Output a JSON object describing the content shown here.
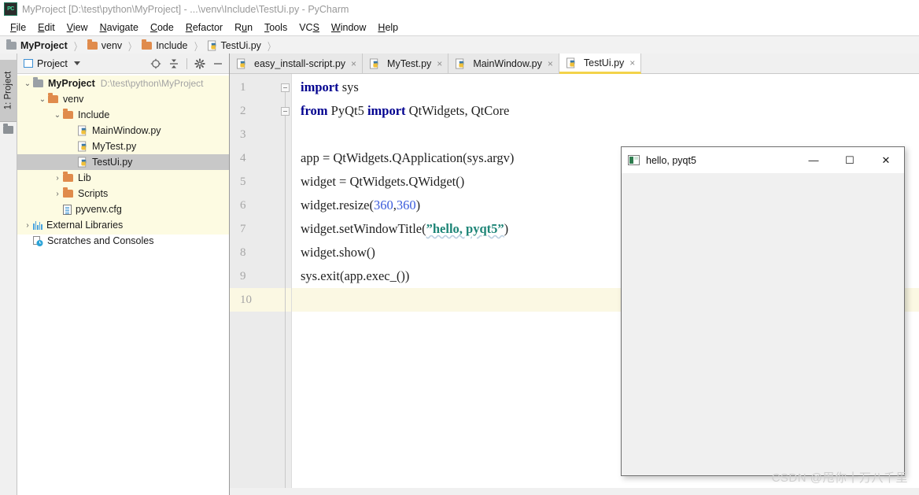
{
  "window": {
    "title": "MyProject [D:\\test\\python\\MyProject] - ...\\venv\\Include\\TestUi.py - PyCharm",
    "app_icon": "PC"
  },
  "menubar": {
    "items": [
      {
        "label": "File",
        "mnemonic": "F"
      },
      {
        "label": "Edit",
        "mnemonic": "E"
      },
      {
        "label": "View",
        "mnemonic": "V"
      },
      {
        "label": "Navigate",
        "mnemonic": "N"
      },
      {
        "label": "Code",
        "mnemonic": "C"
      },
      {
        "label": "Refactor",
        "mnemonic": "R"
      },
      {
        "label": "Run",
        "mnemonic": "u"
      },
      {
        "label": "Tools",
        "mnemonic": "T"
      },
      {
        "label": "VCS",
        "mnemonic": "S"
      },
      {
        "label": "Window",
        "mnemonic": "W"
      },
      {
        "label": "Help",
        "mnemonic": "H"
      }
    ]
  },
  "breadcrumb": {
    "items": [
      {
        "label": "MyProject",
        "icon": "folder-gray-icon",
        "bold": true
      },
      {
        "label": "venv",
        "icon": "folder-orange-icon",
        "bold": false
      },
      {
        "label": "Include",
        "icon": "folder-orange-icon",
        "bold": false
      },
      {
        "label": "TestUi.py",
        "icon": "python-file-icon",
        "bold": false
      }
    ],
    "separator": "〉"
  },
  "toolstrip": {
    "project_tab_label": "1: Project",
    "folder_icon": "folder-icon"
  },
  "project_panel": {
    "header": {
      "title": "Project",
      "window_icon": "project-window-icon",
      "dropdown_icon": "chevron-down-icon",
      "actions": [
        {
          "name": "locate-icon",
          "glyph": "⊕"
        },
        {
          "name": "collapse-all-icon",
          "glyph": "⤓"
        },
        {
          "name": "settings-gear-icon",
          "glyph": "⚙"
        },
        {
          "name": "hide-panel-icon",
          "glyph": "—"
        }
      ]
    },
    "tree": [
      {
        "label": "MyProject",
        "path": "D:\\test\\python\\MyProject",
        "icon": "folder-gray-icon",
        "arrow": "⌄",
        "indent": 0,
        "bold": true,
        "selected": false
      },
      {
        "label": "venv",
        "path": "",
        "icon": "folder-orange-icon",
        "arrow": "⌄",
        "indent": 1,
        "bold": false,
        "selected": false
      },
      {
        "label": "Include",
        "path": "",
        "icon": "folder-orange-icon",
        "arrow": "⌄",
        "indent": 2,
        "bold": false,
        "selected": false
      },
      {
        "label": "MainWindow.py",
        "path": "",
        "icon": "python-file-icon",
        "arrow": "",
        "indent": 3,
        "bold": false,
        "selected": false
      },
      {
        "label": "MyTest.py",
        "path": "",
        "icon": "python-file-icon",
        "arrow": "",
        "indent": 3,
        "bold": false,
        "selected": false
      },
      {
        "label": "TestUi.py",
        "path": "",
        "icon": "python-file-icon",
        "arrow": "",
        "indent": 3,
        "bold": false,
        "selected": true
      },
      {
        "label": "Lib",
        "path": "",
        "icon": "folder-orange-icon",
        "arrow": "›",
        "indent": 2,
        "bold": false,
        "selected": false
      },
      {
        "label": "Scripts",
        "path": "",
        "icon": "folder-orange-icon",
        "arrow": "›",
        "indent": 2,
        "bold": false,
        "selected": false
      },
      {
        "label": "pyvenv.cfg",
        "path": "",
        "icon": "config-file-icon",
        "arrow": "",
        "indent": 2,
        "bold": false,
        "selected": false
      },
      {
        "label": "External Libraries",
        "path": "",
        "icon": "libraries-icon",
        "arrow": "›",
        "indent": 0,
        "bold": false,
        "selected": false
      },
      {
        "label": "Scratches and Consoles",
        "path": "",
        "icon": "scratches-icon",
        "arrow": "",
        "indent": 0,
        "bold": false,
        "selected": false
      }
    ]
  },
  "editor": {
    "tabs": [
      {
        "label": "easy_install-script.py",
        "icon": "python-file-icon",
        "close": "×",
        "active": false
      },
      {
        "label": "MyTest.py",
        "icon": "python-file-icon",
        "close": "×",
        "active": false
      },
      {
        "label": "MainWindow.py",
        "icon": "python-file-icon",
        "close": "×",
        "active": false
      },
      {
        "label": "TestUi.py",
        "icon": "python-file-icon",
        "close": "×",
        "active": true
      }
    ],
    "line_numbers": [
      "1",
      "2",
      "3",
      "4",
      "5",
      "6",
      "7",
      "8",
      "9",
      "10"
    ],
    "current_line": 10,
    "lines": [
      {
        "n": 1,
        "segments": [
          {
            "t": "import",
            "c": "kw"
          },
          {
            "t": " sys",
            "c": ""
          }
        ]
      },
      {
        "n": 2,
        "segments": [
          {
            "t": "from",
            "c": "kw"
          },
          {
            "t": " PyQt5 ",
            "c": ""
          },
          {
            "t": "import",
            "c": "kw"
          },
          {
            "t": " QtWidgets, QtCore",
            "c": ""
          }
        ]
      },
      {
        "n": 3,
        "segments": []
      },
      {
        "n": 4,
        "segments": [
          {
            "t": "app = QtWidgets.QApplication(sys.argv)",
            "c": ""
          }
        ]
      },
      {
        "n": 5,
        "segments": [
          {
            "t": "widget = QtWidgets.QWidget()",
            "c": ""
          }
        ]
      },
      {
        "n": 6,
        "segments": [
          {
            "t": "widget.resize(",
            "c": ""
          },
          {
            "t": "360",
            "c": "num"
          },
          {
            "t": ",",
            "c": ""
          },
          {
            "t": "360",
            "c": "num"
          },
          {
            "t": ")",
            "c": ""
          }
        ]
      },
      {
        "n": 7,
        "segments": [
          {
            "t": "widget.setWindowTitle(",
            "c": ""
          },
          {
            "t": "”hello, pyqt5”",
            "c": "str"
          },
          {
            "t": ")",
            "c": ""
          }
        ]
      },
      {
        "n": 8,
        "segments": [
          {
            "t": "widget.show()",
            "c": ""
          }
        ]
      },
      {
        "n": 9,
        "segments": [
          {
            "t": "sys.exit(app.exec_())",
            "c": ""
          }
        ]
      },
      {
        "n": 10,
        "segments": []
      }
    ]
  },
  "qt_window": {
    "title": "hello, pyqt5",
    "icon": "app-window-icon",
    "buttons": [
      {
        "name": "minimize-button",
        "glyph": "—"
      },
      {
        "name": "maximize-button",
        "glyph": "☐"
      },
      {
        "name": "close-button",
        "glyph": "✕"
      }
    ]
  },
  "watermark": {
    "text": "CSDN @甩你十万八千里"
  },
  "colors": {
    "keyword": "#00008f",
    "number": "#3b5bdb",
    "string": "#1e8577",
    "tab_accent": "#f3d34a",
    "tree_band": "#fdfbe2",
    "current_line": "#fbf8e3"
  }
}
